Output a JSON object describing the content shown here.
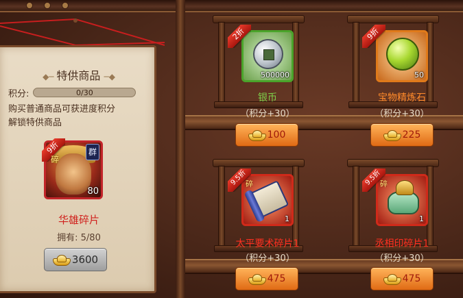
{
  "special_panel": {
    "title": "特供商品",
    "score_label": "积分:",
    "score_text": "0/30",
    "score_progress": 0,
    "description_line1": "购买普通商品可获进度积分",
    "description_line2": "解锁特供商品",
    "item": {
      "discount": "9折",
      "piece_mark": "碎",
      "faction": "群",
      "count": "80",
      "name": "华雄碎片",
      "owned": "拥有: 5/80",
      "price": "3600"
    }
  },
  "shop_items": [
    {
      "discount": "2折",
      "name": "银币",
      "quantity": "500000",
      "score": "（积分+30）",
      "price": "100",
      "icon": "silver-coin-icon",
      "name_color": "#7ed04a",
      "frame_color": "#4aa42a"
    },
    {
      "discount": "9折",
      "name": "宝物精炼石",
      "quantity": "50",
      "score": "（积分+30）",
      "price": "225",
      "icon": "refining-stone-icon",
      "name_color": "#ff8a2a",
      "frame_color": "#e07a1a"
    },
    {
      "discount": "9.5折",
      "piece_mark": "碎",
      "name": "太平要术碎片1",
      "quantity": "1",
      "score": "（积分+30）",
      "price": "475",
      "icon": "scroll-icon",
      "name_color": "#ff3020",
      "frame_color": "#d02a1a"
    },
    {
      "discount": "9.5折",
      "piece_mark": "碎",
      "name": "丞相印碎片1",
      "quantity": "1",
      "score": "（积分+30）",
      "price": "475",
      "icon": "seal-icon",
      "name_color": "#ff3020",
      "frame_color": "#d02a1a"
    }
  ],
  "colors": {
    "price_text": "#a01a0a",
    "panel_bg": "#e9dcc6",
    "hero_name": "#d0201c"
  }
}
